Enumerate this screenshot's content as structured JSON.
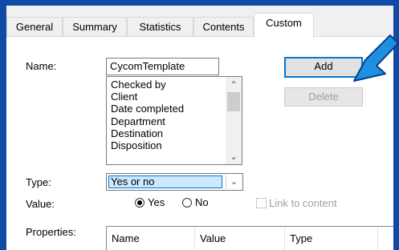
{
  "tabs": [
    {
      "label": "General",
      "active": false
    },
    {
      "label": "Summary",
      "active": false
    },
    {
      "label": "Statistics",
      "active": false
    },
    {
      "label": "Contents",
      "active": false
    },
    {
      "label": "Custom",
      "active": true
    }
  ],
  "form": {
    "name_label": "Name:",
    "name_value": "CycomTemplate",
    "name_options": [
      "Checked by",
      "Client",
      "Date completed",
      "Department",
      "Destination",
      "Disposition"
    ],
    "type_label": "Type:",
    "type_value": "Yes or no",
    "value_label": "Value:",
    "radio_yes": "Yes",
    "radio_no": "No",
    "radio_selected": "Yes",
    "link_to_content": "Link to content",
    "properties_label": "Properties:"
  },
  "buttons": {
    "add": "Add",
    "delete": "Delete"
  },
  "properties_table": {
    "columns": [
      "Name",
      "Value",
      "Type"
    ]
  },
  "annotation": {
    "arrow_color": "#1e90e0",
    "icon": "pointer-arrow-icon"
  },
  "colors": {
    "frame": "#0f4aa6",
    "accent": "#0078d7",
    "selection": "#cce8ff"
  }
}
